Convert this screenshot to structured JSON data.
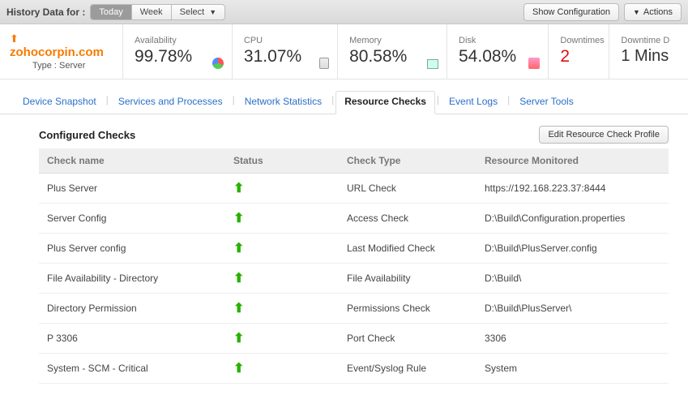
{
  "topbar": {
    "label": "History Data for :",
    "segments": [
      "Today",
      "Week",
      "Select"
    ],
    "active_segment": 0,
    "show_config": "Show Configuration",
    "actions": "Actions"
  },
  "identity": {
    "domain": "zohocorpin.com",
    "type_label": "Type : Server"
  },
  "metrics": {
    "availability": {
      "label": "Availability",
      "value": "99.78%"
    },
    "cpu": {
      "label": "CPU",
      "value": "31.07%"
    },
    "memory": {
      "label": "Memory",
      "value": "80.58%"
    },
    "disk": {
      "label": "Disk",
      "value": "54.08%"
    },
    "downtimes": {
      "label": "Downtimes",
      "value": "2"
    },
    "downtime_duration": {
      "label": "Downtime D",
      "value": "1 Mins"
    }
  },
  "tabs": {
    "items": [
      "Device Snapshot",
      "Services and Processes",
      "Network Statistics",
      "Resource Checks",
      "Event Logs",
      "Server Tools"
    ],
    "active": 3
  },
  "section": {
    "title": "Configured Checks",
    "edit_button": "Edit Resource Check Profile",
    "columns": [
      "Check name",
      "Status",
      "Check Type",
      "Resource Monitored"
    ]
  },
  "checks": [
    {
      "name": "Plus Server",
      "status": "up",
      "type": "URL Check",
      "resource": "https://192.168.223.37:8444"
    },
    {
      "name": "Server Config",
      "status": "up",
      "type": "Access Check",
      "resource": "D:\\Build\\Configuration.properties"
    },
    {
      "name": "Plus Server config",
      "status": "up",
      "type": "Last Modified Check",
      "resource": "D:\\Build\\PlusServer.config"
    },
    {
      "name": "File Availability - Directory",
      "status": "up",
      "type": "File Availability",
      "resource": "D:\\Build\\"
    },
    {
      "name": "Directory Permission",
      "status": "up",
      "type": "Permissions Check",
      "resource": "D:\\Build\\PlusServer\\"
    },
    {
      "name": "P 3306",
      "status": "up",
      "type": "Port Check",
      "resource": "3306"
    },
    {
      "name": "System - SCM - Critical",
      "status": "up",
      "type": "Event/Syslog Rule",
      "resource": "System"
    }
  ]
}
